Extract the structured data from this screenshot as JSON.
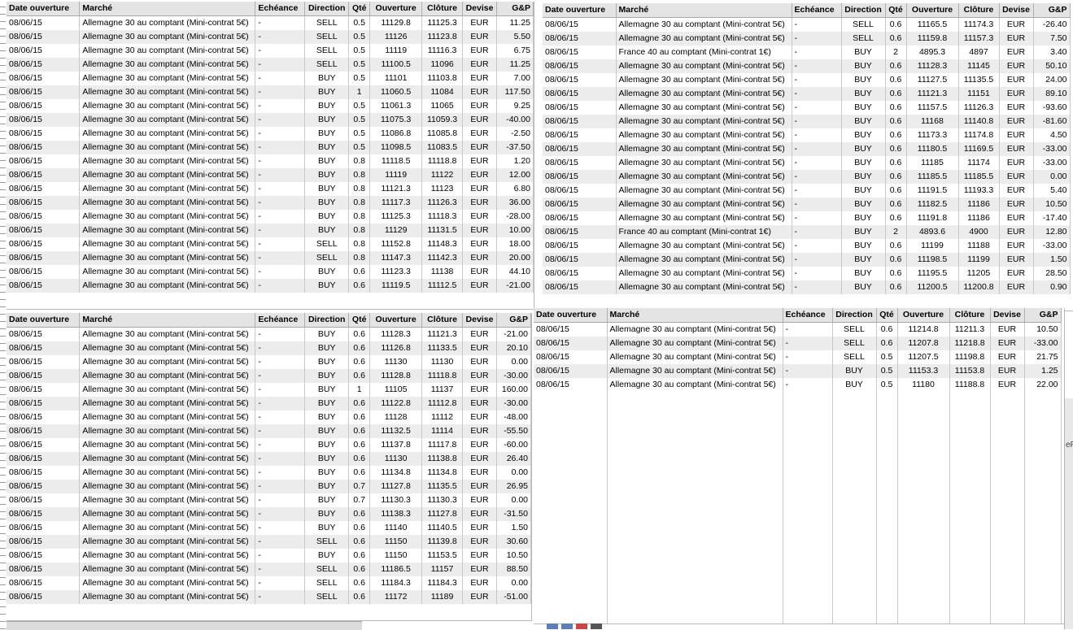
{
  "headers": {
    "date": "Date ouverture",
    "market": "Marché",
    "expiry": "Echéance",
    "direction": "Direction",
    "qty": "Qté",
    "open": "Ouverture",
    "close": "Clôture",
    "currency": "Devise",
    "pnl": "G&P"
  },
  "panels": [
    {
      "id": "panel-tl",
      "rows": [
        [
          "08/06/15",
          "Allemagne 30 au comptant (Mini-contrat 5€)",
          "-",
          "SELL",
          "0.5",
          "11129.8",
          "11125.3",
          "EUR",
          "11.25"
        ],
        [
          "08/06/15",
          "Allemagne 30 au comptant (Mini-contrat 5€)",
          "-",
          "SELL",
          "0.5",
          "11126",
          "11123.8",
          "EUR",
          "5.50"
        ],
        [
          "08/06/15",
          "Allemagne 30 au comptant (Mini-contrat 5€)",
          "-",
          "SELL",
          "0.5",
          "11119",
          "11116.3",
          "EUR",
          "6.75"
        ],
        [
          "08/06/15",
          "Allemagne 30 au comptant (Mini-contrat 5€)",
          "-",
          "SELL",
          "0.5",
          "11100.5",
          "11096",
          "EUR",
          "11.25"
        ],
        [
          "08/06/15",
          "Allemagne 30 au comptant (Mini-contrat 5€)",
          "-",
          "BUY",
          "0.5",
          "11101",
          "11103.8",
          "EUR",
          "7.00"
        ],
        [
          "08/06/15",
          "Allemagne 30 au comptant (Mini-contrat 5€)",
          "-",
          "BUY",
          "1",
          "11060.5",
          "11084",
          "EUR",
          "117.50"
        ],
        [
          "08/06/15",
          "Allemagne 30 au comptant (Mini-contrat 5€)",
          "-",
          "BUY",
          "0.5",
          "11061.3",
          "11065",
          "EUR",
          "9.25"
        ],
        [
          "08/06/15",
          "Allemagne 30 au comptant (Mini-contrat 5€)",
          "-",
          "BUY",
          "0.5",
          "11075.3",
          "11059.3",
          "EUR",
          "-40.00"
        ],
        [
          "08/06/15",
          "Allemagne 30 au comptant (Mini-contrat 5€)",
          "-",
          "BUY",
          "0.5",
          "11086.8",
          "11085.8",
          "EUR",
          "-2.50"
        ],
        [
          "08/06/15",
          "Allemagne 30 au comptant (Mini-contrat 5€)",
          "-",
          "BUY",
          "0.5",
          "11098.5",
          "11083.5",
          "EUR",
          "-37.50"
        ],
        [
          "08/06/15",
          "Allemagne 30 au comptant (Mini-contrat 5€)",
          "-",
          "BUY",
          "0.8",
          "11118.5",
          "11118.8",
          "EUR",
          "1.20"
        ],
        [
          "08/06/15",
          "Allemagne 30 au comptant (Mini-contrat 5€)",
          "-",
          "BUY",
          "0.8",
          "11119",
          "11122",
          "EUR",
          "12.00"
        ],
        [
          "08/06/15",
          "Allemagne 30 au comptant (Mini-contrat 5€)",
          "-",
          "BUY",
          "0.8",
          "11121.3",
          "11123",
          "EUR",
          "6.80"
        ],
        [
          "08/06/15",
          "Allemagne 30 au comptant (Mini-contrat 5€)",
          "-",
          "BUY",
          "0.8",
          "11117.3",
          "11126.3",
          "EUR",
          "36.00"
        ],
        [
          "08/06/15",
          "Allemagne 30 au comptant (Mini-contrat 5€)",
          "-",
          "BUY",
          "0.8",
          "11125.3",
          "11118.3",
          "EUR",
          "-28.00"
        ],
        [
          "08/06/15",
          "Allemagne 30 au comptant (Mini-contrat 5€)",
          "-",
          "BUY",
          "0.8",
          "11129",
          "11131.5",
          "EUR",
          "10.00"
        ],
        [
          "08/06/15",
          "Allemagne 30 au comptant (Mini-contrat 5€)",
          "-",
          "SELL",
          "0.8",
          "11152.8",
          "11148.3",
          "EUR",
          "18.00"
        ],
        [
          "08/06/15",
          "Allemagne 30 au comptant (Mini-contrat 5€)",
          "-",
          "SELL",
          "0.8",
          "11147.3",
          "11142.3",
          "EUR",
          "20.00"
        ],
        [
          "08/06/15",
          "Allemagne 30 au comptant (Mini-contrat 5€)",
          "-",
          "BUY",
          "0.6",
          "11123.3",
          "11138",
          "EUR",
          "44.10"
        ],
        [
          "08/06/15",
          "Allemagne 30 au comptant (Mini-contrat 5€)",
          "-",
          "BUY",
          "0.6",
          "11119.5",
          "11112.5",
          "EUR",
          "-21.00"
        ]
      ]
    },
    {
      "id": "panel-tr",
      "rows": [
        [
          "08/06/15",
          "Allemagne 30 au comptant (Mini-contrat 5€)",
          "-",
          "SELL",
          "0.6",
          "11165.5",
          "11174.3",
          "EUR",
          "-26.40"
        ],
        [
          "08/06/15",
          "Allemagne 30 au comptant (Mini-contrat 5€)",
          "-",
          "SELL",
          "0.6",
          "11159.8",
          "11157.3",
          "EUR",
          "7.50"
        ],
        [
          "08/06/15",
          "France 40 au comptant (Mini-contrat 1€)",
          "-",
          "BUY",
          "2",
          "4895.3",
          "4897",
          "EUR",
          "3.40"
        ],
        [
          "08/06/15",
          "Allemagne 30 au comptant (Mini-contrat 5€)",
          "-",
          "BUY",
          "0.6",
          "11128.3",
          "11145",
          "EUR",
          "50.10"
        ],
        [
          "08/06/15",
          "Allemagne 30 au comptant (Mini-contrat 5€)",
          "-",
          "BUY",
          "0.6",
          "11127.5",
          "11135.5",
          "EUR",
          "24.00"
        ],
        [
          "08/06/15",
          "Allemagne 30 au comptant (Mini-contrat 5€)",
          "-",
          "BUY",
          "0.6",
          "11121.3",
          "11151",
          "EUR",
          "89.10"
        ],
        [
          "08/06/15",
          "Allemagne 30 au comptant (Mini-contrat 5€)",
          "-",
          "BUY",
          "0.6",
          "11157.5",
          "11126.3",
          "EUR",
          "-93.60"
        ],
        [
          "08/06/15",
          "Allemagne 30 au comptant (Mini-contrat 5€)",
          "-",
          "BUY",
          "0.6",
          "11168",
          "11140.8",
          "EUR",
          "-81.60"
        ],
        [
          "08/06/15",
          "Allemagne 30 au comptant (Mini-contrat 5€)",
          "-",
          "BUY",
          "0.6",
          "11173.3",
          "11174.8",
          "EUR",
          "4.50"
        ],
        [
          "08/06/15",
          "Allemagne 30 au comptant (Mini-contrat 5€)",
          "-",
          "BUY",
          "0.6",
          "11180.5",
          "11169.5",
          "EUR",
          "-33.00"
        ],
        [
          "08/06/15",
          "Allemagne 30 au comptant (Mini-contrat 5€)",
          "-",
          "BUY",
          "0.6",
          "11185",
          "11174",
          "EUR",
          "-33.00"
        ],
        [
          "08/06/15",
          "Allemagne 30 au comptant (Mini-contrat 5€)",
          "-",
          "BUY",
          "0.6",
          "11185.5",
          "11185.5",
          "EUR",
          "0.00"
        ],
        [
          "08/06/15",
          "Allemagne 30 au comptant (Mini-contrat 5€)",
          "-",
          "BUY",
          "0.6",
          "11191.5",
          "11193.3",
          "EUR",
          "5.40"
        ],
        [
          "08/06/15",
          "Allemagne 30 au comptant (Mini-contrat 5€)",
          "-",
          "BUY",
          "0.6",
          "11182.5",
          "11186",
          "EUR",
          "10.50"
        ],
        [
          "08/06/15",
          "Allemagne 30 au comptant (Mini-contrat 5€)",
          "-",
          "BUY",
          "0.6",
          "11191.8",
          "11186",
          "EUR",
          "-17.40"
        ],
        [
          "08/06/15",
          "France 40 au comptant (Mini-contrat 1€)",
          "-",
          "BUY",
          "2",
          "4893.6",
          "4900",
          "EUR",
          "12.80"
        ],
        [
          "08/06/15",
          "Allemagne 30 au comptant (Mini-contrat 5€)",
          "-",
          "BUY",
          "0.6",
          "11199",
          "11188",
          "EUR",
          "-33.00"
        ],
        [
          "08/06/15",
          "Allemagne 30 au comptant (Mini-contrat 5€)",
          "-",
          "BUY",
          "0.6",
          "11198.5",
          "11199",
          "EUR",
          "1.50"
        ],
        [
          "08/06/15",
          "Allemagne 30 au comptant (Mini-contrat 5€)",
          "-",
          "BUY",
          "0.6",
          "11195.5",
          "11205",
          "EUR",
          "28.50"
        ],
        [
          "08/06/15",
          "Allemagne 30 au comptant (Mini-contrat 5€)",
          "-",
          "BUY",
          "0.6",
          "11200.5",
          "11200.8",
          "EUR",
          "0.90"
        ]
      ]
    },
    {
      "id": "panel-bl",
      "rows": [
        [
          "08/06/15",
          "Allemagne 30 au comptant (Mini-contrat 5€)",
          "-",
          "BUY",
          "0.6",
          "11128.3",
          "11121.3",
          "EUR",
          "-21.00"
        ],
        [
          "08/06/15",
          "Allemagne 30 au comptant (Mini-contrat 5€)",
          "-",
          "BUY",
          "0.6",
          "11126.8",
          "11133.5",
          "EUR",
          "20.10"
        ],
        [
          "08/06/15",
          "Allemagne 30 au comptant (Mini-contrat 5€)",
          "-",
          "BUY",
          "0.6",
          "11130",
          "11130",
          "EUR",
          "0.00"
        ],
        [
          "08/06/15",
          "Allemagne 30 au comptant (Mini-contrat 5€)",
          "-",
          "BUY",
          "0.6",
          "11128.8",
          "11118.8",
          "EUR",
          "-30.00"
        ],
        [
          "08/06/15",
          "Allemagne 30 au comptant (Mini-contrat 5€)",
          "-",
          "BUY",
          "1",
          "11105",
          "11137",
          "EUR",
          "160.00"
        ],
        [
          "08/06/15",
          "Allemagne 30 au comptant (Mini-contrat 5€)",
          "-",
          "BUY",
          "0.6",
          "11122.8",
          "11112.8",
          "EUR",
          "-30.00"
        ],
        [
          "08/06/15",
          "Allemagne 30 au comptant (Mini-contrat 5€)",
          "-",
          "BUY",
          "0.6",
          "11128",
          "11112",
          "EUR",
          "-48.00"
        ],
        [
          "08/06/15",
          "Allemagne 30 au comptant (Mini-contrat 5€)",
          "-",
          "BUY",
          "0.6",
          "11132.5",
          "11114",
          "EUR",
          "-55.50"
        ],
        [
          "08/06/15",
          "Allemagne 30 au comptant (Mini-contrat 5€)",
          "-",
          "BUY",
          "0.6",
          "11137.8",
          "11117.8",
          "EUR",
          "-60.00"
        ],
        [
          "08/06/15",
          "Allemagne 30 au comptant (Mini-contrat 5€)",
          "-",
          "BUY",
          "0.6",
          "11130",
          "11138.8",
          "EUR",
          "26.40"
        ],
        [
          "08/06/15",
          "Allemagne 30 au comptant (Mini-contrat 5€)",
          "-",
          "BUY",
          "0.6",
          "11134.8",
          "11134.8",
          "EUR",
          "0.00"
        ],
        [
          "08/06/15",
          "Allemagne 30 au comptant (Mini-contrat 5€)",
          "-",
          "BUY",
          "0.7",
          "11127.8",
          "11135.5",
          "EUR",
          "26.95"
        ],
        [
          "08/06/15",
          "Allemagne 30 au comptant (Mini-contrat 5€)",
          "-",
          "BUY",
          "0.7",
          "11130.3",
          "11130.3",
          "EUR",
          "0.00"
        ],
        [
          "08/06/15",
          "Allemagne 30 au comptant (Mini-contrat 5€)",
          "-",
          "BUY",
          "0.6",
          "11138.3",
          "11127.8",
          "EUR",
          "-31.50"
        ],
        [
          "08/06/15",
          "Allemagne 30 au comptant (Mini-contrat 5€)",
          "-",
          "BUY",
          "0.6",
          "11140",
          "11140.5",
          "EUR",
          "1.50"
        ],
        [
          "08/06/15",
          "Allemagne 30 au comptant (Mini-contrat 5€)",
          "-",
          "SELL",
          "0.6",
          "11150",
          "11139.8",
          "EUR",
          "30.60"
        ],
        [
          "08/06/15",
          "Allemagne 30 au comptant (Mini-contrat 5€)",
          "-",
          "BUY",
          "0.6",
          "11150",
          "11153.5",
          "EUR",
          "10.50"
        ],
        [
          "08/06/15",
          "Allemagne 30 au comptant (Mini-contrat 5€)",
          "-",
          "SELL",
          "0.6",
          "11186.5",
          "11157",
          "EUR",
          "88.50"
        ],
        [
          "08/06/15",
          "Allemagne 30 au comptant (Mini-contrat 5€)",
          "-",
          "SELL",
          "0.6",
          "11184.3",
          "11184.3",
          "EUR",
          "0.00"
        ],
        [
          "08/06/15",
          "Allemagne 30 au comptant (Mini-contrat 5€)",
          "-",
          "SELL",
          "0.6",
          "11172",
          "11189",
          "EUR",
          "-51.00"
        ]
      ]
    },
    {
      "id": "panel-br",
      "rows": [
        [
          "08/06/15",
          "Allemagne 30 au comptant (Mini-contrat 5€)",
          "-",
          "SELL",
          "0.6",
          "11214.8",
          "11211.3",
          "EUR",
          "10.50"
        ],
        [
          "08/06/15",
          "Allemagne 30 au comptant (Mini-contrat 5€)",
          "-",
          "SELL",
          "0.6",
          "11207.8",
          "11218.8",
          "EUR",
          "-33.00"
        ],
        [
          "08/06/15",
          "Allemagne 30 au comptant (Mini-contrat 5€)",
          "-",
          "SELL",
          "0.5",
          "11207.5",
          "11198.8",
          "EUR",
          "21.75"
        ],
        [
          "08/06/15",
          "Allemagne 30 au comptant (Mini-contrat 5€)",
          "-",
          "BUY",
          "0.5",
          "11153.3",
          "11153.8",
          "EUR",
          "1.25"
        ],
        [
          "08/06/15",
          "Allemagne 30 au comptant (Mini-contrat 5€)",
          "-",
          "BUY",
          "0.5",
          "11180",
          "11188.8",
          "EUR",
          "22.00"
        ]
      ]
    }
  ],
  "edge_fragment": "eF"
}
